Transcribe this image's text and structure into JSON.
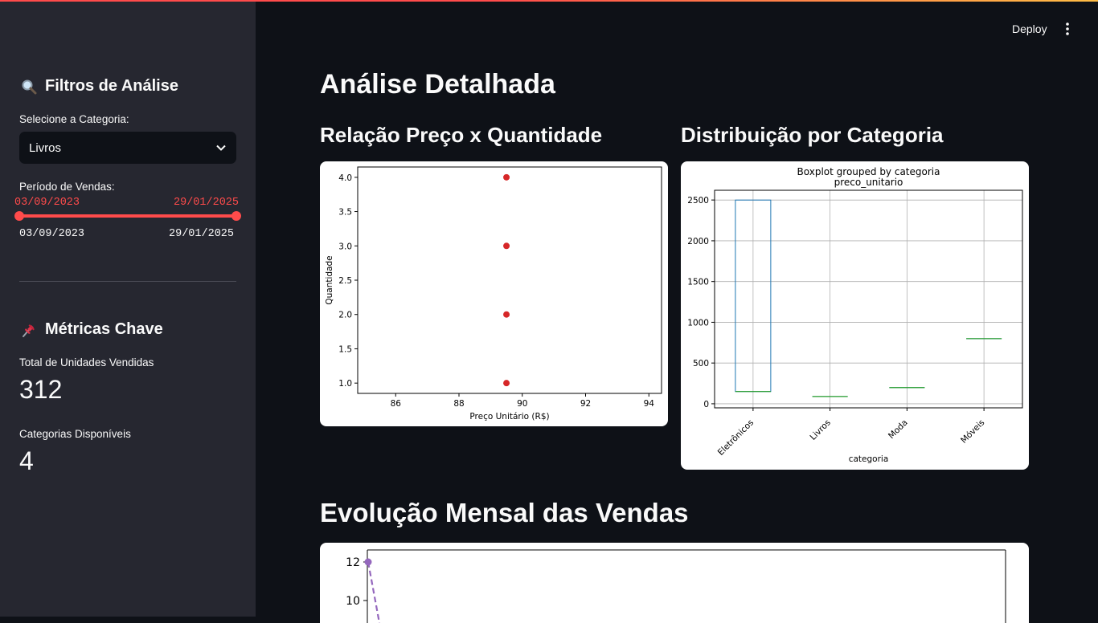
{
  "sidebar": {
    "filters_title": "Filtros de Análise",
    "filters_icon": "magnifier-icon",
    "category_label": "Selecione a Categoria:",
    "category_value": "Livros",
    "period_label": "Período de Vendas:",
    "period_start": "03/09/2023",
    "period_end": "29/01/2025",
    "range_min": "03/09/2023",
    "range_max": "29/01/2025",
    "metrics_title": "Métricas Chave",
    "metrics_icon": "pushpin-icon",
    "metrics": [
      {
        "label": "Total de Unidades Vendidas",
        "value": "312"
      },
      {
        "label": "Categorias Disponíveis",
        "value": "4"
      }
    ]
  },
  "header": {
    "deploy_label": "Deploy"
  },
  "main": {
    "title": "Análise Detalhada",
    "scatter_title": "Relação Preço x Quantidade",
    "box_title": "Distribuição por Categoria",
    "monthly_title": "Evolução Mensal das Vendas"
  },
  "chart_data": [
    {
      "type": "scatter",
      "xlabel": "Preço Unitário (R$)",
      "ylabel": "Quantidade",
      "xlim": [
        84.8,
        94.4
      ],
      "ylim": [
        0.85,
        4.15
      ],
      "xticks": [
        86,
        88,
        90,
        92,
        94
      ],
      "yticks": [
        1.0,
        1.5,
        2.0,
        2.5,
        3.0,
        3.5,
        4.0
      ],
      "points": [
        {
          "x": 89.5,
          "y": 4.0
        },
        {
          "x": 89.5,
          "y": 3.0
        },
        {
          "x": 89.5,
          "y": 2.0
        },
        {
          "x": 89.5,
          "y": 1.0
        }
      ],
      "color": "#d62728",
      "grid": false
    },
    {
      "type": "box",
      "title": "Boxplot grouped by categoria",
      "subtitle": "preco_unitario",
      "xlabel": "categoria",
      "categories": [
        "Eletrônicos",
        "Livros",
        "Moda",
        "Móveis"
      ],
      "ylim": [
        -50,
        2620
      ],
      "yticks": [
        0,
        500,
        1000,
        1500,
        2000,
        2500
      ],
      "boxes": [
        {
          "q1": 150,
          "median": 150,
          "q3": 2500
        },
        {
          "q1": 89.5,
          "median": 89.5,
          "q3": 89.5
        },
        {
          "q1": 199,
          "median": 199,
          "q3": 199
        },
        {
          "q1": 799,
          "median": 799,
          "q3": 799
        }
      ],
      "box_color": "#1f77b4",
      "median_color": "#2ca02c",
      "grid": true
    },
    {
      "type": "line",
      "visible_yticks": [
        10,
        12
      ],
      "visible_points": [
        {
          "y": 12
        }
      ],
      "color": "#9467bd",
      "line_style": "dashed"
    }
  ]
}
